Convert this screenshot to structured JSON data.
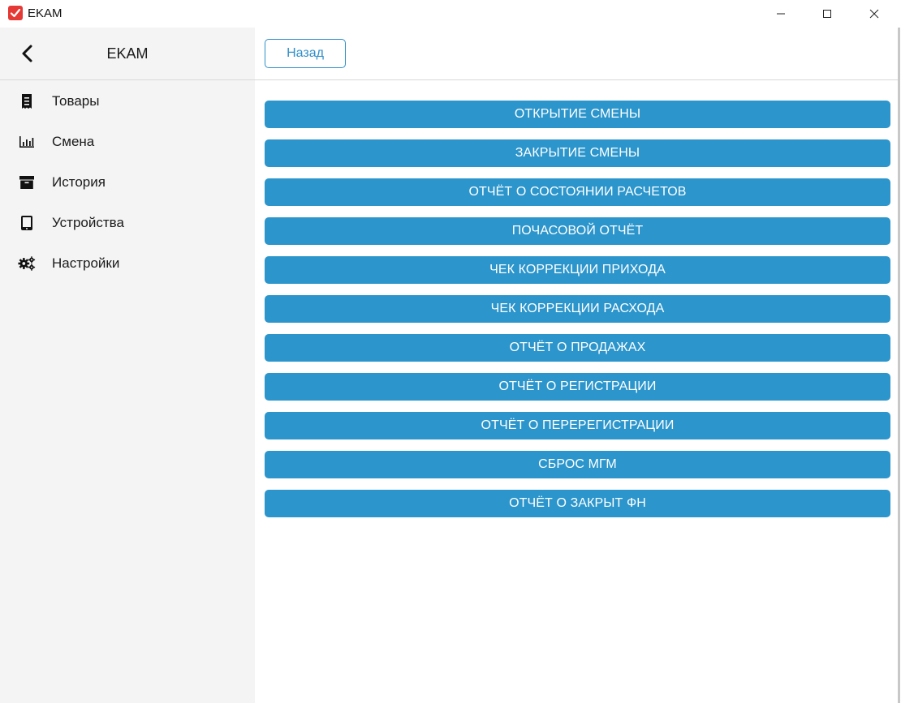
{
  "window": {
    "title": "EKAM",
    "accent": "#e53935"
  },
  "sidebar": {
    "title": "EKAM",
    "items": [
      {
        "label": "Товары",
        "icon": "receipt-icon"
      },
      {
        "label": "Смена",
        "icon": "bar-chart-icon"
      },
      {
        "label": "История",
        "icon": "archive-icon"
      },
      {
        "label": "Устройства",
        "icon": "tablet-icon"
      },
      {
        "label": "Настройки",
        "icon": "gears-icon"
      }
    ]
  },
  "toolbar": {
    "back_label": "Назад"
  },
  "reports": [
    "ОТКРЫТИЕ СМЕНЫ",
    "ЗАКРЫТИЕ СМЕНЫ",
    "ОТЧЁТ О СОСТОЯНИИ РАСЧЕТОВ",
    "ПОЧАСОВОЙ ОТЧЁТ",
    "ЧЕК КОРРЕКЦИИ ПРИХОДА",
    "ЧЕК КОРРЕКЦИИ РАСХОДА",
    "ОТЧЁТ О ПРОДАЖАХ",
    "ОТЧЁТ О РЕГИСТРАЦИИ",
    "ОТЧЁТ О ПЕРЕРЕГИСТРАЦИИ",
    "СБРОС МГМ",
    "ОТЧЁТ О ЗАКРЫТ ФН"
  ],
  "colors": {
    "primary": "#2b95cc",
    "outline": "#2f8fc9",
    "sidebar_bg": "#f4f4f4"
  }
}
